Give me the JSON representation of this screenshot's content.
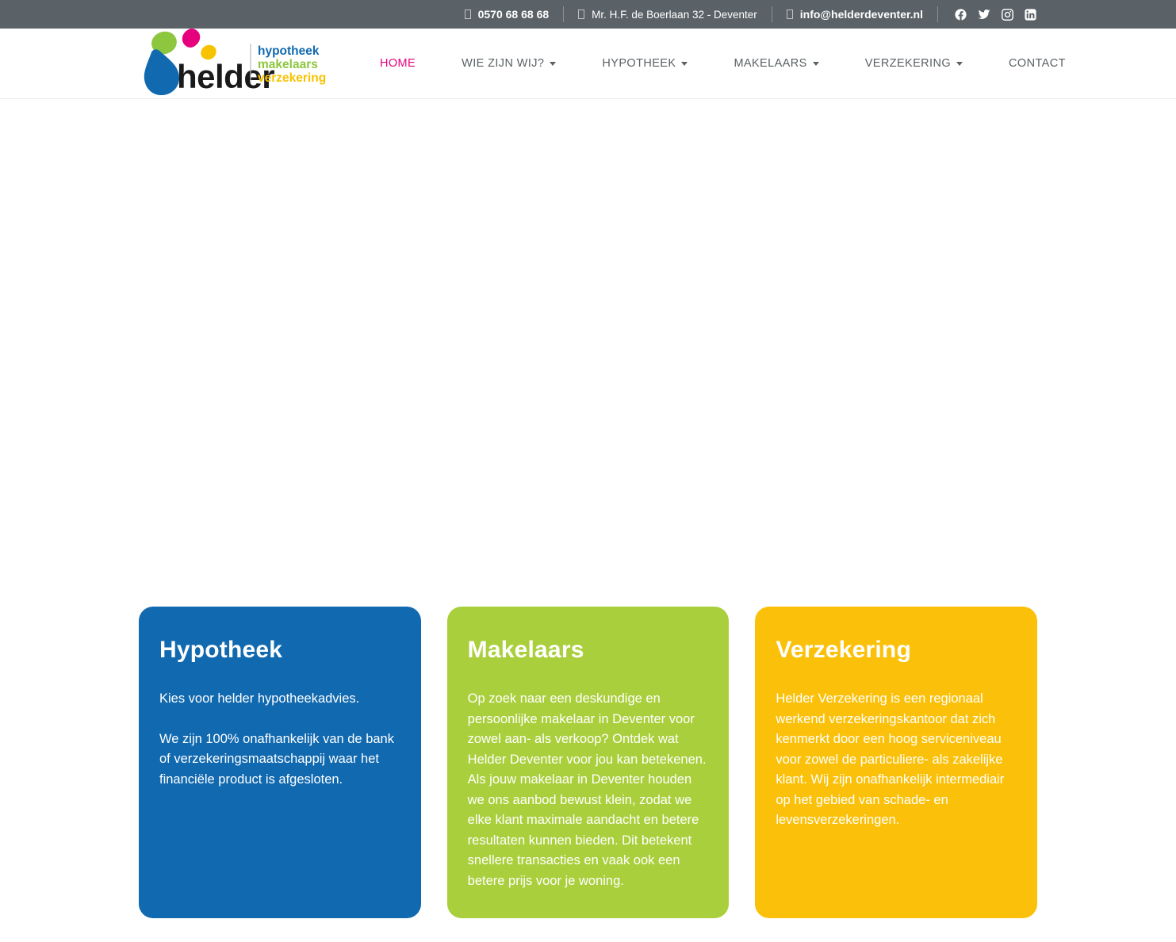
{
  "topbar": {
    "background": "#5a6268",
    "phone": {
      "icon": "phone-icon",
      "label": "0570 68 68 68"
    },
    "address": {
      "icon": "map-marker-icon",
      "label": "Mr. H.F. de Boerlaan 32 - Deventer"
    },
    "email": {
      "icon": "envelope-icon",
      "label": "info@helderdeventer.nl"
    },
    "socials": [
      {
        "name": "facebook-icon",
        "label": "Facebook"
      },
      {
        "name": "twitter-icon",
        "label": "Twitter"
      },
      {
        "name": "instagram-icon",
        "label": "Instagram"
      },
      {
        "name": "linkedin-icon",
        "label": "LinkedIn"
      }
    ]
  },
  "logo": {
    "wordmark": "helder",
    "tagline": [
      "hypotheek",
      "makelaars",
      "verzekering"
    ],
    "colors": {
      "blue": "#1169b0",
      "green": "#8dc63f",
      "pink": "#e6007e",
      "yellow": "#f7c300",
      "wordmark": "#1a1a1a"
    }
  },
  "nav": {
    "active_color": "#e6007e",
    "items": [
      {
        "label": "HOME",
        "active": true,
        "dropdown": false
      },
      {
        "label": "WIE ZIJN WIJ?",
        "active": false,
        "dropdown": true
      },
      {
        "label": "HYPOTHEEK",
        "active": false,
        "dropdown": true
      },
      {
        "label": "MAKELAARS",
        "active": false,
        "dropdown": true
      },
      {
        "label": "VERZEKERING",
        "active": false,
        "dropdown": true
      },
      {
        "label": "CONTACT",
        "active": false,
        "dropdown": false
      }
    ]
  },
  "cards": [
    {
      "title": "Hypotheek",
      "color": "#1169b0",
      "paragraphs": [
        "Kies voor helder hypotheekadvies.",
        "We zijn 100% onafhankelijk van de bank of verzekeringsmaatschappij waar het financiële product is afgesloten."
      ]
    },
    {
      "title": "Makelaars",
      "color": "#aacf3c",
      "paragraphs": [
        "Op zoek naar een deskundige en persoonlijke makelaar in Deventer voor zowel aan- als verkoop? Ontdek wat Helder Deventer voor jou kan betekenen. Als jouw makelaar in Deventer houden we ons aanbod bewust klein, zodat we elke klant maximale aandacht en betere resultaten kunnen bieden. Dit betekent snellere transacties en vaak ook een betere prijs voor je woning."
      ]
    },
    {
      "title": "Verzekering",
      "color": "#fbc10a",
      "paragraphs": [
        "Helder Verzekering is een regionaal werkend verzekeringskantoor dat zich kenmerkt door een hoog serviceniveau voor zowel de particuliere- als zakelijke klant. Wij zijn onafhankelijk intermediair op het gebied van schade- en levensverzekeringen."
      ]
    }
  ]
}
